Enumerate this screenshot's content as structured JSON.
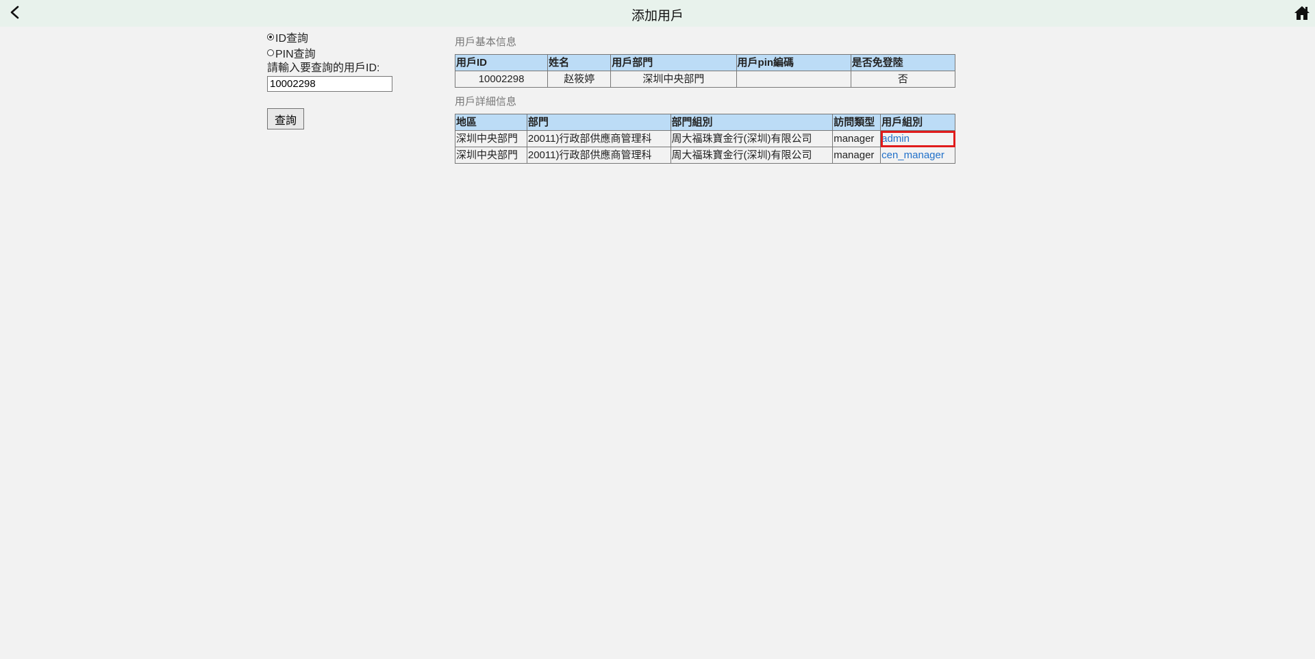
{
  "header": {
    "title": "添加用戶",
    "back_icon": "chevron-left-icon",
    "home_icon": "home-icon"
  },
  "search": {
    "radio_id_label": "ID查詢",
    "radio_pin_label": "PIN查詢",
    "selected": "id",
    "prompt": "請輸入要查詢的用戶ID:",
    "input_value": "10002298",
    "button_label": "查詢"
  },
  "basic_info": {
    "title": "用戶基本信息",
    "headers": [
      "用戶ID",
      "姓名",
      "用戶部門",
      "用戶pin編碼",
      "是否免登陸"
    ],
    "row": [
      "10002298",
      "赵筱婷",
      "深圳中央部門",
      "",
      "否"
    ]
  },
  "detail_info": {
    "title": "用戶詳細信息",
    "headers": [
      "地區",
      "部門",
      "部門組別",
      "訪問類型",
      "用戶組別"
    ],
    "rows": [
      [
        "深圳中央部門",
        "20011)行政部供應商管理科",
        "周大福珠寶金行(深圳)有限公司",
        "manager",
        "admin"
      ],
      [
        "深圳中央部門",
        "20011)行政部供應商管理科",
        "周大福珠寶金行(深圳)有限公司",
        "manager",
        "cen_manager"
      ]
    ],
    "highlighted_cell": "admin"
  },
  "colors": {
    "header_bg": "#e8f2ec",
    "table_header_bg": "#bcdcf6",
    "link": "#2170c9",
    "highlight_border": "#e01b1b"
  }
}
